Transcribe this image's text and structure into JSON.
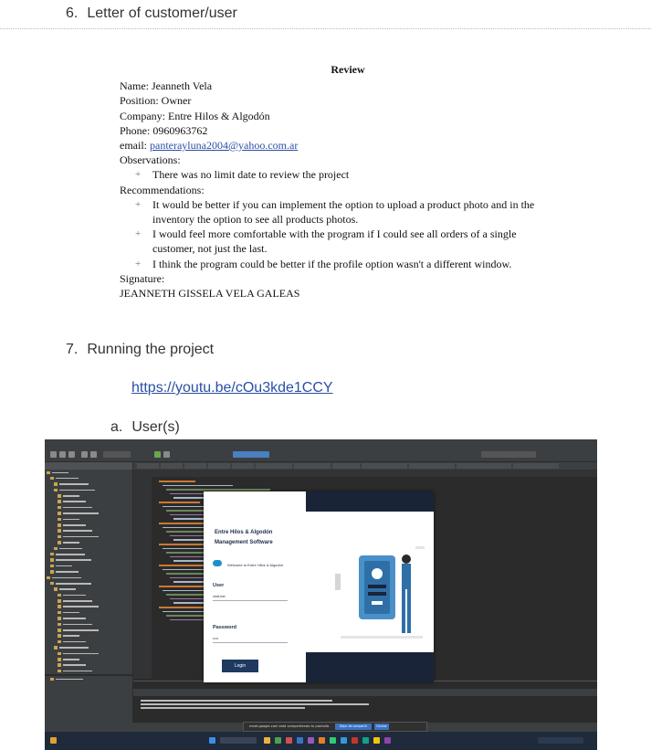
{
  "section6": {
    "number": "6.",
    "title": "Letter of customer/user"
  },
  "letter": {
    "heading": "Review",
    "name": "Name: Jeanneth Vela",
    "position": "Position: Owner",
    "company": "Company: Entre Hilos & Algodón",
    "phone": "Phone: 0960963762",
    "email_label": "email: ",
    "email": "panterayluna2004@yahoo.com.ar",
    "observations_label": "Observations:",
    "observations": [
      "There was no limit date to review the project"
    ],
    "recommendations_label": "Recommendations:",
    "recommendations": [
      "It would be better if you can implement the option to upload a product photo and in the inventory the option to see all products photos.",
      "I would feel more comfortable with the program if I could see all orders of a single customer, not just the last.",
      "I think the program could be better if the profile option wasn't a different window."
    ],
    "bullet": "+",
    "signature_label": "Signature:",
    "signature": "JEANNETH GISSELA VELA GALEAS"
  },
  "section7": {
    "number": "7.",
    "title": "Running the project",
    "link": "https://youtu.be/cOu3kde1CCY"
  },
  "subsection_a": {
    "number": "a.",
    "title": "User(s)"
  },
  "screenshot": {
    "app": {
      "brand_line1": "Entre Hilos & Algodón",
      "brand_line2": "Management Software",
      "welcome": "Welcome to Entre Hilos & Algodón",
      "user_label": "User",
      "user_value": "newUser",
      "password_label": "Password",
      "password_value": "•••••",
      "login_button": "Login"
    },
    "toast": {
      "text": "meet.google.com está compartiendo tu pantalla.",
      "stop_button": "Dejar de compartir",
      "hide_button": "Ocultar"
    },
    "colors": {
      "ide_bg": "#2b2b2b",
      "app_navy": "#1a2438",
      "login_blue": "#1e3a5f"
    }
  }
}
